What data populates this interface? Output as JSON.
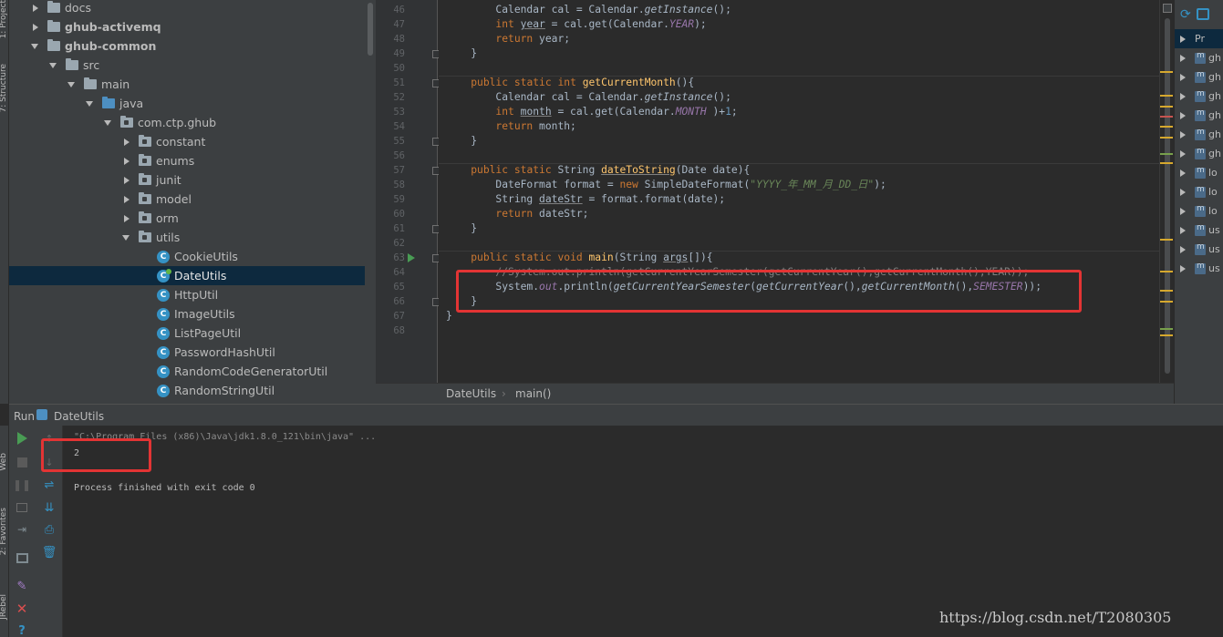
{
  "left_strip": {
    "top_labels": [
      "1: Project",
      "7: Structure"
    ],
    "bottom_labels": [
      "Web",
      "2: Favorites",
      "JRebel"
    ]
  },
  "project_tree": [
    {
      "label": "docs",
      "arrow": "right",
      "icon": "folder",
      "indent": 0,
      "bold": false
    },
    {
      "label": "ghub-activemq",
      "arrow": "right",
      "icon": "folder",
      "indent": 0,
      "bold": true
    },
    {
      "label": "ghub-common",
      "arrow": "down",
      "icon": "folder",
      "indent": 0,
      "bold": true
    },
    {
      "label": "src",
      "arrow": "down",
      "icon": "folder",
      "indent": 1,
      "bold": false
    },
    {
      "label": "main",
      "arrow": "down",
      "icon": "folder",
      "indent": 2,
      "bold": false
    },
    {
      "label": "java",
      "arrow": "down",
      "icon": "folder-blue",
      "indent": 3,
      "bold": false
    },
    {
      "label": "com.ctp.ghub",
      "arrow": "down",
      "icon": "package",
      "indent": 4,
      "bold": false
    },
    {
      "label": "constant",
      "arrow": "right",
      "icon": "package",
      "indent": 5,
      "bold": false
    },
    {
      "label": "enums",
      "arrow": "right",
      "icon": "package",
      "indent": 5,
      "bold": false
    },
    {
      "label": "junit",
      "arrow": "right",
      "icon": "package",
      "indent": 5,
      "bold": false
    },
    {
      "label": "model",
      "arrow": "right",
      "icon": "package",
      "indent": 5,
      "bold": false
    },
    {
      "label": "orm",
      "arrow": "right",
      "icon": "package",
      "indent": 5,
      "bold": false
    },
    {
      "label": "utils",
      "arrow": "down",
      "icon": "package",
      "indent": 5,
      "bold": false
    },
    {
      "label": "CookieUtils",
      "arrow": "none",
      "icon": "class",
      "indent": 6,
      "bold": false
    },
    {
      "label": "DateUtils",
      "arrow": "none",
      "icon": "class-mod",
      "indent": 6,
      "bold": false,
      "selected": true
    },
    {
      "label": "HttpUtil",
      "arrow": "none",
      "icon": "class",
      "indent": 6,
      "bold": false
    },
    {
      "label": "ImageUtils",
      "arrow": "none",
      "icon": "class",
      "indent": 6,
      "bold": false
    },
    {
      "label": "ListPageUtil",
      "arrow": "none",
      "icon": "class",
      "indent": 6,
      "bold": false
    },
    {
      "label": "PasswordHashUtil",
      "arrow": "none",
      "icon": "class",
      "indent": 6,
      "bold": false
    },
    {
      "label": "RandomCodeGeneratorUtil",
      "arrow": "none",
      "icon": "class",
      "indent": 6,
      "bold": false
    },
    {
      "label": "RandomStringUtil",
      "arrow": "none",
      "icon": "class",
      "indent": 6,
      "bold": false
    }
  ],
  "class_icon_letter": "C",
  "editor": {
    "line_numbers": [
      "46",
      "47",
      "48",
      "49",
      "50",
      "51",
      "52",
      "53",
      "54",
      "55",
      "56",
      "57",
      "58",
      "59",
      "60",
      "61",
      "62",
      "63",
      "64",
      "65",
      "66",
      "67",
      "68"
    ],
    "lines": [
      "        Calendar cal = Calendar.getInstance();",
      "        int year = cal.get(Calendar.YEAR);",
      "        return year;",
      "    }",
      "",
      "    public static int getCurrentMonth(){",
      "        Calendar cal = Calendar.getInstance();",
      "        int month = cal.get(Calendar.MONTH )+1;",
      "        return month;",
      "    }",
      "",
      "    public static String dateToString(Date date){",
      "        DateFormat format = new SimpleDateFormat(\"YYYY_年_MM_月_DD_日\");",
      "        String dateStr = format.format(date);",
      "        return dateStr;",
      "    }",
      "",
      "    public static void main(String args[]){",
      "        //System.out.println(getCurrentYearSemester(getCurrentYear(),getCurrentMonth(),YEAR));",
      "        System.out.println(getCurrentYearSemester(getCurrentYear(),getCurrentMonth(),SEMESTER));",
      "    }",
      "}",
      ""
    ],
    "breadcrumb": [
      "DateUtils",
      "main()"
    ],
    "breadcrumb_separator": "›"
  },
  "maven_panel": {
    "items": [
      "Pr",
      "gh",
      "gh",
      "gh",
      "gh",
      "gh",
      "gh",
      "lo",
      "lo",
      "lo",
      "us",
      "us",
      "us"
    ]
  },
  "run_panel": {
    "tab_label": "Run",
    "config_name": "DateUtils",
    "console_lines": [
      "\"C:\\Program Files (x86)\\Java\\jdk1.8.0_121\\bin\\java\" ...",
      "2",
      "",
      "Process finished with exit code 0"
    ]
  },
  "colors": {
    "accent_red": "#e33434",
    "selection": "#0d293e",
    "keyword": "#cc7832",
    "method": "#ffc66d",
    "constant": "#9876aa"
  },
  "watermark": "https://blog.csdn.net/T2080305"
}
